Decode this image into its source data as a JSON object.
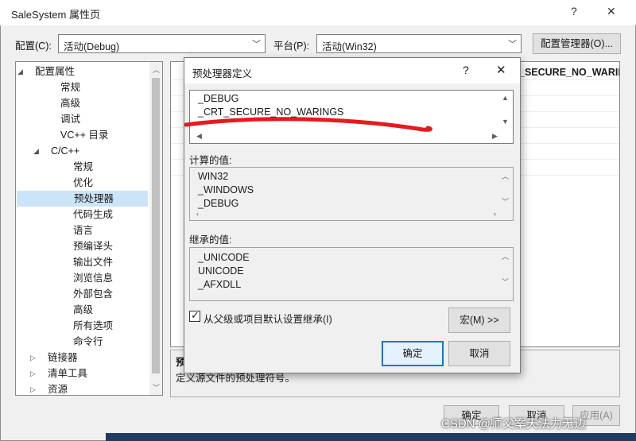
{
  "window": {
    "title": "SaleSystem 属性页",
    "help": "?",
    "close": "✕"
  },
  "toolbar": {
    "config_label": "配置(C):",
    "config_value": "活动(Debug)",
    "platform_label": "平台(P):",
    "platform_value": "活动(Win32)",
    "config_manager_label": "配置管理器(O)..."
  },
  "tree": {
    "items": [
      {
        "label": "配置属性",
        "caret": "◢"
      },
      {
        "label": "常规"
      },
      {
        "label": "高级"
      },
      {
        "label": "调试"
      },
      {
        "label": "VC++ 目录"
      },
      {
        "label": "C/C++",
        "caret": "◢"
      },
      {
        "label": "常规"
      },
      {
        "label": "优化"
      },
      {
        "label": "预处理器",
        "selected": true
      },
      {
        "label": "代码生成"
      },
      {
        "label": "语言"
      },
      {
        "label": "预编译头"
      },
      {
        "label": "输出文件"
      },
      {
        "label": "浏览信息"
      },
      {
        "label": "外部包含"
      },
      {
        "label": "高级"
      },
      {
        "label": "所有选项"
      },
      {
        "label": "命令行"
      },
      {
        "label": "链接器",
        "caret": "▷"
      },
      {
        "label": "清单工具",
        "caret": "▷"
      },
      {
        "label": "资源",
        "caret": "▷"
      }
    ]
  },
  "grid": {
    "visible_value": "_SECURE_NO_WARIN"
  },
  "description": {
    "title": "预",
    "text": "定义源文件的预处理符号。"
  },
  "footer": {
    "ok": "确定",
    "cancel": "取消",
    "apply": "应用(A)"
  },
  "dialog": {
    "title": "预处理器定义",
    "help": "?",
    "close": "✕",
    "definitions": [
      "_DEBUG",
      "_CRT_SECURE_NO_WARINGS"
    ],
    "computed_label": "计算的值:",
    "computed_values": [
      "WIN32",
      "_WINDOWS",
      "_DEBUG"
    ],
    "inherited_label": "继承的值:",
    "inherited_values": [
      "_UNICODE",
      "UNICODE",
      "_AFXDLL"
    ],
    "inherit_checkbox_label": "从父级或项目默认设置继承(I)",
    "inherit_checked": true,
    "macro_button": "宏(M) >>",
    "ok": "确定",
    "cancel": "取消",
    "annotation_color": "#e8191e"
  },
  "watermark": "CSDN @师父案天法力无边"
}
